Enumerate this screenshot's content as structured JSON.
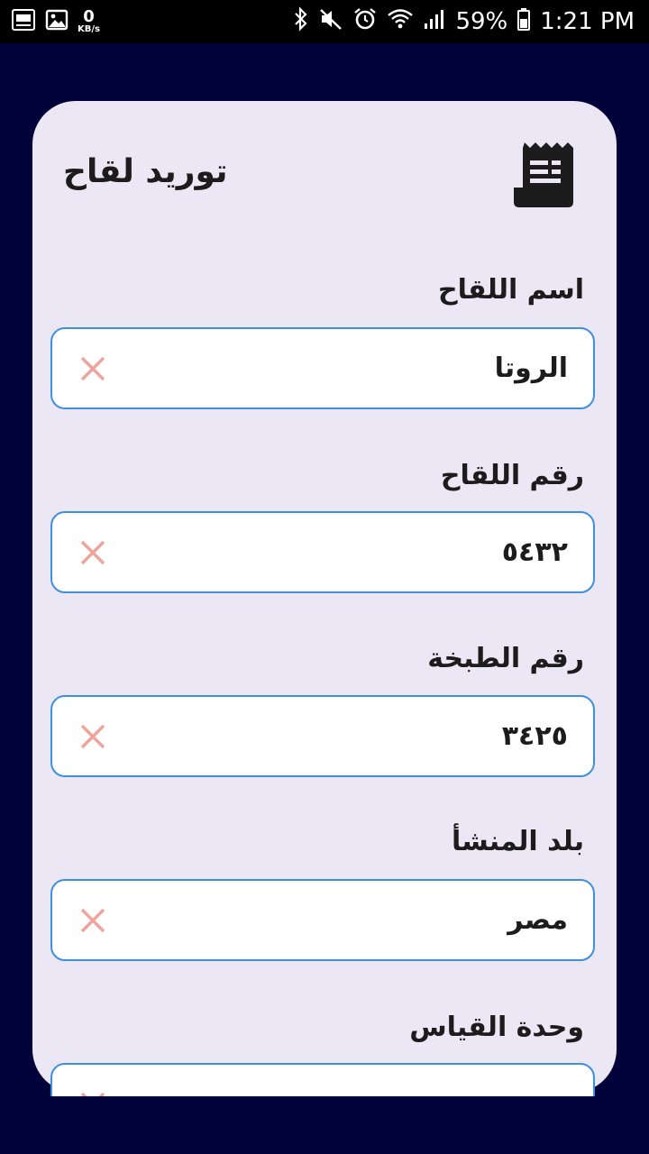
{
  "status_bar": {
    "net_speed_value": "0",
    "net_speed_unit": "KB/s",
    "battery": "59%",
    "time": "1:21 PM"
  },
  "header": {
    "title": "توريد لقاح",
    "icon": "receipt-icon"
  },
  "fields": [
    {
      "label": "اسم اللقاح",
      "value": "الروتا"
    },
    {
      "label": "رقم اللقاح",
      "value": "٥٤٣٢"
    },
    {
      "label": "رقم الطبخة",
      "value": "٣٤٢٥"
    },
    {
      "label": "بلد المنشأ",
      "value": "مصر"
    },
    {
      "label": "وحدة القياس",
      "value": ""
    }
  ],
  "colors": {
    "background": "#02023a",
    "card": "#ece7f4",
    "field_border": "#3d8fe0",
    "clear_icon": "#f0a39a"
  }
}
